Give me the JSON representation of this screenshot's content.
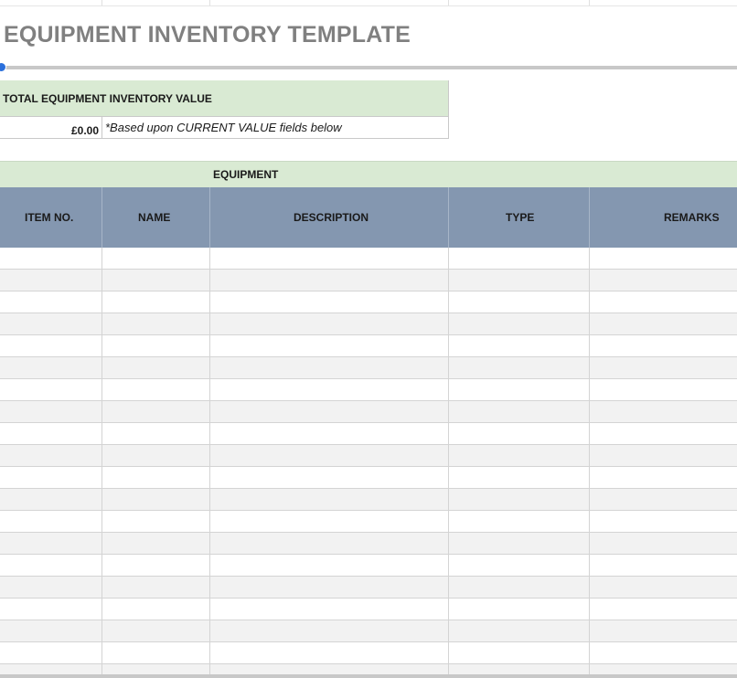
{
  "document": {
    "title": "EQUIPMENT INVENTORY TEMPLATE"
  },
  "summary": {
    "total_label": "TOTAL EQUIPMENT INVENTORY VALUE",
    "total_value": "£0.00",
    "note": "*Based upon CURRENT VALUE fields below"
  },
  "section": {
    "label": "EQUIPMENT"
  },
  "table": {
    "columns": [
      "ITEM NO.",
      "NAME",
      "DESCRIPTION",
      "TYPE",
      "REMARKS"
    ],
    "rows": [
      [
        "",
        "",
        "",
        "",
        ""
      ],
      [
        "",
        "",
        "",
        "",
        ""
      ],
      [
        "",
        "",
        "",
        "",
        ""
      ],
      [
        "",
        "",
        "",
        "",
        ""
      ],
      [
        "",
        "",
        "",
        "",
        ""
      ],
      [
        "",
        "",
        "",
        "",
        ""
      ],
      [
        "",
        "",
        "",
        "",
        ""
      ],
      [
        "",
        "",
        "",
        "",
        ""
      ],
      [
        "",
        "",
        "",
        "",
        ""
      ],
      [
        "",
        "",
        "",
        "",
        ""
      ],
      [
        "",
        "",
        "",
        "",
        ""
      ],
      [
        "",
        "",
        "",
        "",
        ""
      ],
      [
        "",
        "",
        "",
        "",
        ""
      ],
      [
        "",
        "",
        "",
        "",
        ""
      ],
      [
        "",
        "",
        "",
        "",
        ""
      ],
      [
        "",
        "",
        "",
        "",
        ""
      ],
      [
        "",
        "",
        "",
        "",
        ""
      ],
      [
        "",
        "",
        "",
        "",
        ""
      ],
      [
        "",
        "",
        "",
        "",
        ""
      ],
      [
        "",
        "",
        "",
        "",
        ""
      ]
    ]
  },
  "colors": {
    "title": "#808080",
    "green_band": "#d9ead3",
    "header_fill": "#8497b0",
    "alt_row": "#f2f2f2",
    "selection": "#2a6fdb"
  }
}
